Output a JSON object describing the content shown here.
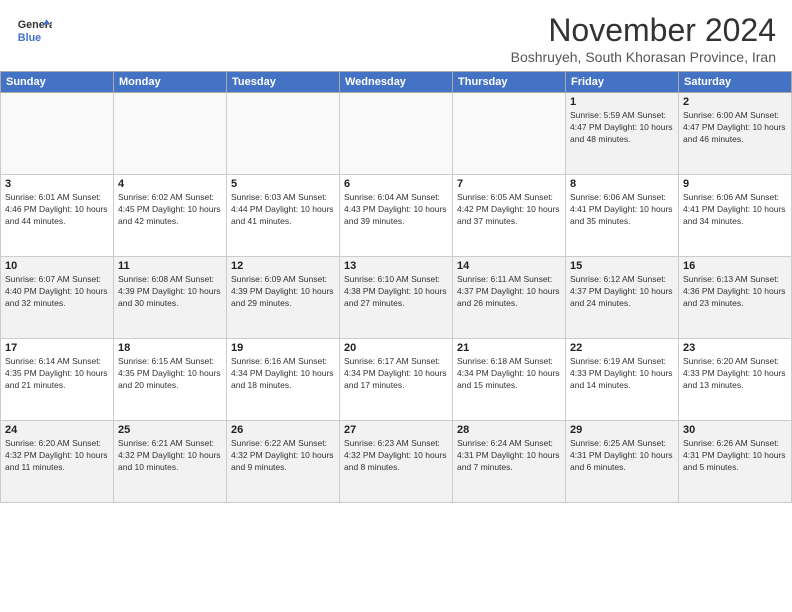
{
  "header": {
    "logo_line1": "General",
    "logo_line2": "Blue",
    "month": "November 2024",
    "location": "Boshruyeh, South Khorasan Province, Iran"
  },
  "weekdays": [
    "Sunday",
    "Monday",
    "Tuesday",
    "Wednesday",
    "Thursday",
    "Friday",
    "Saturday"
  ],
  "weeks": [
    [
      {
        "day": "",
        "info": ""
      },
      {
        "day": "",
        "info": ""
      },
      {
        "day": "",
        "info": ""
      },
      {
        "day": "",
        "info": ""
      },
      {
        "day": "",
        "info": ""
      },
      {
        "day": "1",
        "info": "Sunrise: 5:59 AM\nSunset: 4:47 PM\nDaylight: 10 hours and 48 minutes."
      },
      {
        "day": "2",
        "info": "Sunrise: 6:00 AM\nSunset: 4:47 PM\nDaylight: 10 hours and 46 minutes."
      }
    ],
    [
      {
        "day": "3",
        "info": "Sunrise: 6:01 AM\nSunset: 4:46 PM\nDaylight: 10 hours and 44 minutes."
      },
      {
        "day": "4",
        "info": "Sunrise: 6:02 AM\nSunset: 4:45 PM\nDaylight: 10 hours and 42 minutes."
      },
      {
        "day": "5",
        "info": "Sunrise: 6:03 AM\nSunset: 4:44 PM\nDaylight: 10 hours and 41 minutes."
      },
      {
        "day": "6",
        "info": "Sunrise: 6:04 AM\nSunset: 4:43 PM\nDaylight: 10 hours and 39 minutes."
      },
      {
        "day": "7",
        "info": "Sunrise: 6:05 AM\nSunset: 4:42 PM\nDaylight: 10 hours and 37 minutes."
      },
      {
        "day": "8",
        "info": "Sunrise: 6:06 AM\nSunset: 4:41 PM\nDaylight: 10 hours and 35 minutes."
      },
      {
        "day": "9",
        "info": "Sunrise: 6:06 AM\nSunset: 4:41 PM\nDaylight: 10 hours and 34 minutes."
      }
    ],
    [
      {
        "day": "10",
        "info": "Sunrise: 6:07 AM\nSunset: 4:40 PM\nDaylight: 10 hours and 32 minutes."
      },
      {
        "day": "11",
        "info": "Sunrise: 6:08 AM\nSunset: 4:39 PM\nDaylight: 10 hours and 30 minutes."
      },
      {
        "day": "12",
        "info": "Sunrise: 6:09 AM\nSunset: 4:39 PM\nDaylight: 10 hours and 29 minutes."
      },
      {
        "day": "13",
        "info": "Sunrise: 6:10 AM\nSunset: 4:38 PM\nDaylight: 10 hours and 27 minutes."
      },
      {
        "day": "14",
        "info": "Sunrise: 6:11 AM\nSunset: 4:37 PM\nDaylight: 10 hours and 26 minutes."
      },
      {
        "day": "15",
        "info": "Sunrise: 6:12 AM\nSunset: 4:37 PM\nDaylight: 10 hours and 24 minutes."
      },
      {
        "day": "16",
        "info": "Sunrise: 6:13 AM\nSunset: 4:36 PM\nDaylight: 10 hours and 23 minutes."
      }
    ],
    [
      {
        "day": "17",
        "info": "Sunrise: 6:14 AM\nSunset: 4:35 PM\nDaylight: 10 hours and 21 minutes."
      },
      {
        "day": "18",
        "info": "Sunrise: 6:15 AM\nSunset: 4:35 PM\nDaylight: 10 hours and 20 minutes."
      },
      {
        "day": "19",
        "info": "Sunrise: 6:16 AM\nSunset: 4:34 PM\nDaylight: 10 hours and 18 minutes."
      },
      {
        "day": "20",
        "info": "Sunrise: 6:17 AM\nSunset: 4:34 PM\nDaylight: 10 hours and 17 minutes."
      },
      {
        "day": "21",
        "info": "Sunrise: 6:18 AM\nSunset: 4:34 PM\nDaylight: 10 hours and 15 minutes."
      },
      {
        "day": "22",
        "info": "Sunrise: 6:19 AM\nSunset: 4:33 PM\nDaylight: 10 hours and 14 minutes."
      },
      {
        "day": "23",
        "info": "Sunrise: 6:20 AM\nSunset: 4:33 PM\nDaylight: 10 hours and 13 minutes."
      }
    ],
    [
      {
        "day": "24",
        "info": "Sunrise: 6:20 AM\nSunset: 4:32 PM\nDaylight: 10 hours and 11 minutes."
      },
      {
        "day": "25",
        "info": "Sunrise: 6:21 AM\nSunset: 4:32 PM\nDaylight: 10 hours and 10 minutes."
      },
      {
        "day": "26",
        "info": "Sunrise: 6:22 AM\nSunset: 4:32 PM\nDaylight: 10 hours and 9 minutes."
      },
      {
        "day": "27",
        "info": "Sunrise: 6:23 AM\nSunset: 4:32 PM\nDaylight: 10 hours and 8 minutes."
      },
      {
        "day": "28",
        "info": "Sunrise: 6:24 AM\nSunset: 4:31 PM\nDaylight: 10 hours and 7 minutes."
      },
      {
        "day": "29",
        "info": "Sunrise: 6:25 AM\nSunset: 4:31 PM\nDaylight: 10 hours and 6 minutes."
      },
      {
        "day": "30",
        "info": "Sunrise: 6:26 AM\nSunset: 4:31 PM\nDaylight: 10 hours and 5 minutes."
      }
    ]
  ]
}
